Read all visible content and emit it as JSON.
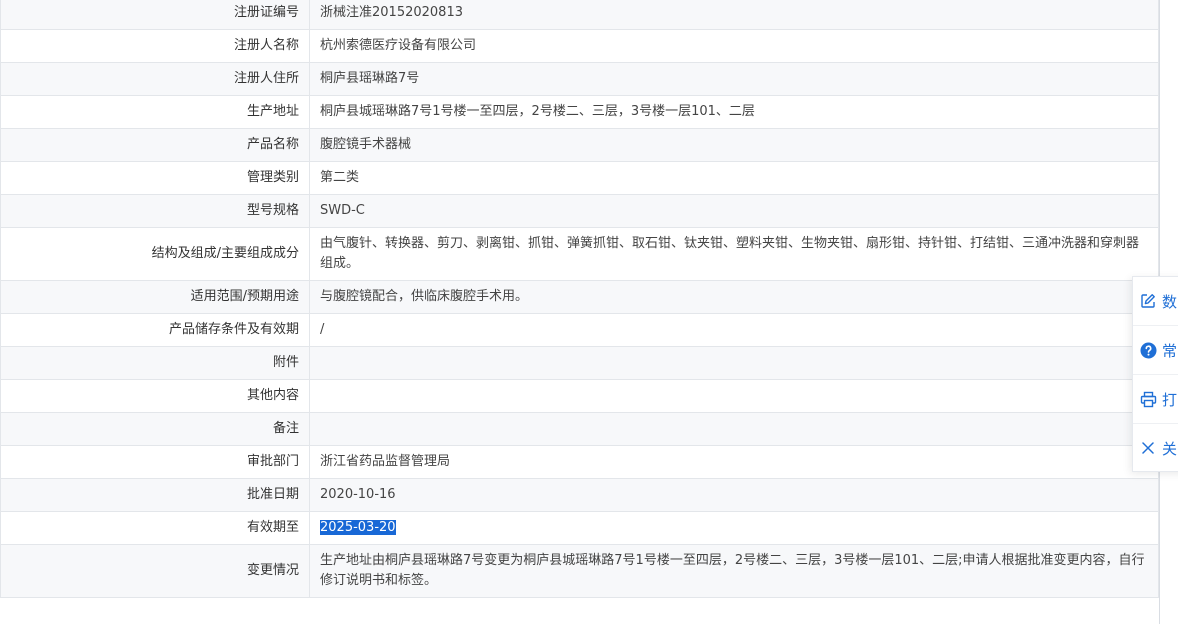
{
  "rows": [
    {
      "label": "注册证编号",
      "value": "浙械注准20152020813"
    },
    {
      "label": "注册人名称",
      "value": "杭州索德医疗设备有限公司"
    },
    {
      "label": "注册人住所",
      "value": "桐庐县瑶琳路7号"
    },
    {
      "label": "生产地址",
      "value": "桐庐县城瑶琳路7号1号楼一至四层，2号楼二、三层，3号楼一层101、二层"
    },
    {
      "label": "产品名称",
      "value": "腹腔镜手术器械"
    },
    {
      "label": "管理类别",
      "value": "第二类"
    },
    {
      "label": "型号规格",
      "value": "SWD-C"
    },
    {
      "label": "结构及组成/主要组成成分",
      "value": "由气腹针、转换器、剪刀、剥离钳、抓钳、弹簧抓钳、取石钳、钛夹钳、塑料夹钳、生物夹钳、扇形钳、持针钳、打结钳、三通冲洗器和穿刺器组成。"
    },
    {
      "label": "适用范围/预期用途",
      "value": "与腹腔镜配合，供临床腹腔手术用。"
    },
    {
      "label": "产品储存条件及有效期",
      "value": "/"
    },
    {
      "label": "附件",
      "value": ""
    },
    {
      "label": "其他内容",
      "value": ""
    },
    {
      "label": "备注",
      "value": ""
    },
    {
      "label": "审批部门",
      "value": "浙江省药品监督管理局"
    },
    {
      "label": "批准日期",
      "value": "2020-10-16"
    },
    {
      "label": "有效期至",
      "value": "2025-03-20"
    },
    {
      "label": "变更情况",
      "value": "生产地址由桐庐县瑶琳路7号变更为桐庐县城瑶琳路7号1号楼一至四层，2号楼二、三层，3号楼一层101、二层;申请人根据批准变更内容，自行修订说明书和标签。"
    }
  ],
  "float_panel": {
    "items": [
      {
        "icon": "edit-icon",
        "label": "数"
      },
      {
        "icon": "help-circle-icon",
        "label": "常"
      },
      {
        "icon": "printer-icon",
        "label": "打"
      },
      {
        "icon": "close-icon",
        "label": "关"
      }
    ]
  },
  "colors": {
    "accent": "#1f6fd6",
    "selection": "#1868d6",
    "row_alt": "#f7f8fa",
    "border": "#e3e6ea"
  }
}
